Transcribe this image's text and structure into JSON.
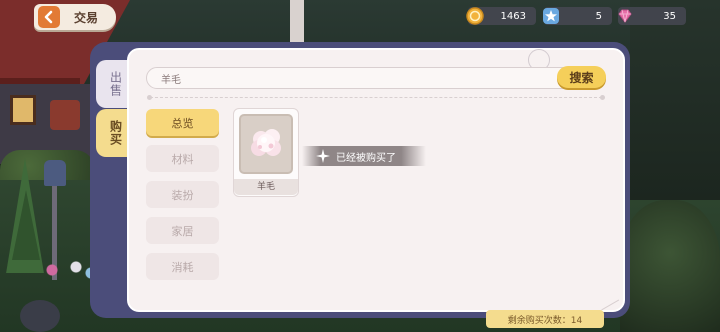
{
  "header": {
    "back_label": "交易"
  },
  "currencies": {
    "coins": "1463",
    "stars": "5",
    "gems": "35"
  },
  "side_tabs": {
    "sell": "出售",
    "buy": "购买"
  },
  "search": {
    "value": "羊毛",
    "button_label": "搜索"
  },
  "categories": [
    {
      "label": "总览",
      "active": true
    },
    {
      "label": "材料",
      "active": false
    },
    {
      "label": "装扮",
      "active": false
    },
    {
      "label": "家居",
      "active": false
    },
    {
      "label": "消耗",
      "active": false
    }
  ],
  "item": {
    "name": "羊毛",
    "icon": "wool-icon"
  },
  "status": {
    "sold_text": "已经被购买了"
  },
  "footer": {
    "remaining": "剩余购买次数：14"
  },
  "colors": {
    "accent": "#f5cf5a",
    "panel_frame": "#4b4d7a",
    "panel_bg": "#f7f1f1"
  }
}
